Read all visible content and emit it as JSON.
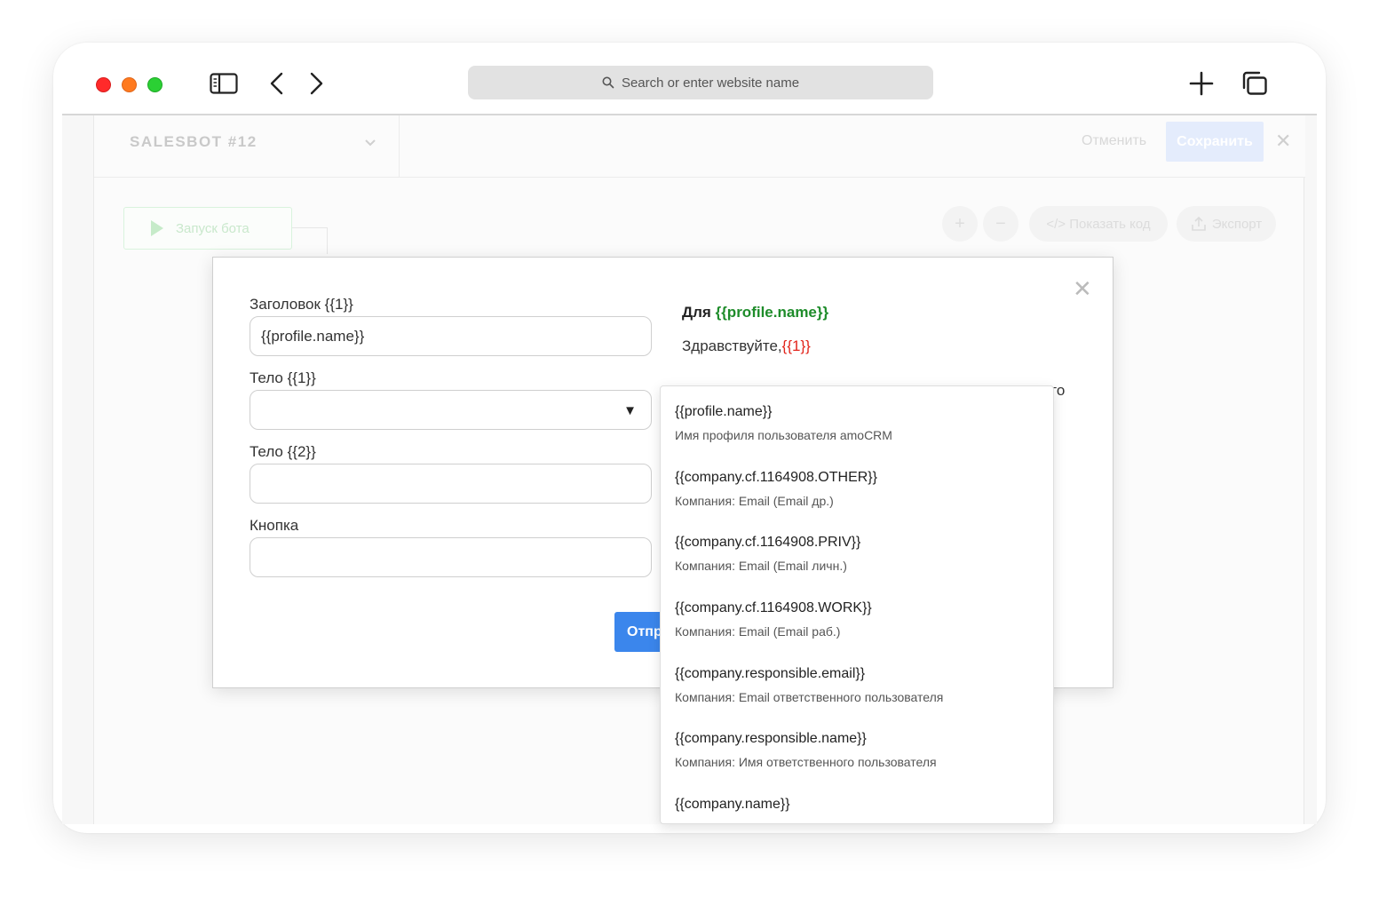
{
  "browser": {
    "address_placeholder": "Search or enter website name"
  },
  "bot_header": {
    "title": "SALESBOT #12",
    "cancel_label": "Отменить",
    "save_label": "Сохранить"
  },
  "canvas": {
    "start_label": "Запуск бота",
    "tools": {
      "zoom_in": "+",
      "zoom_out": "−",
      "show_code": "</> Показать код",
      "export": "Экспорт"
    }
  },
  "modal": {
    "fields": [
      {
        "label": "Заголовок {{1}}",
        "value": "{{profile.name}}"
      },
      {
        "label": "Тело {{1}}",
        "value": ""
      },
      {
        "label": "Тело {{2}}",
        "value": ""
      },
      {
        "label": "Кнопка",
        "value": ""
      }
    ],
    "send_label": "Отпр",
    "preview": {
      "for_prefix": "Для",
      "for_var": "{{profile.name}}",
      "hello_prefix": "Здравствуйте,",
      "hello_var": "{{1}}",
      "cut_text": "го"
    }
  },
  "dropdown": {
    "items": [
      {
        "code": "{{profile.name}}",
        "desc": "Имя профиля пользователя amoCRM"
      },
      {
        "code": "{{company.cf.1164908.OTHER}}",
        "desc": "Компания: Email (Email др.)"
      },
      {
        "code": "{{company.cf.1164908.PRIV}}",
        "desc": "Компания: Email (Email личн.)"
      },
      {
        "code": "{{company.cf.1164908.WORK}}",
        "desc": "Компания: Email (Email раб.)"
      },
      {
        "code": "{{company.responsible.email}}",
        "desc": "Компания: Email ответственного пользователя"
      },
      {
        "code": "{{company.responsible.name}}",
        "desc": "Компания: Имя ответственного пользователя"
      },
      {
        "code": "{{company.name}}",
        "desc": ""
      }
    ]
  }
}
